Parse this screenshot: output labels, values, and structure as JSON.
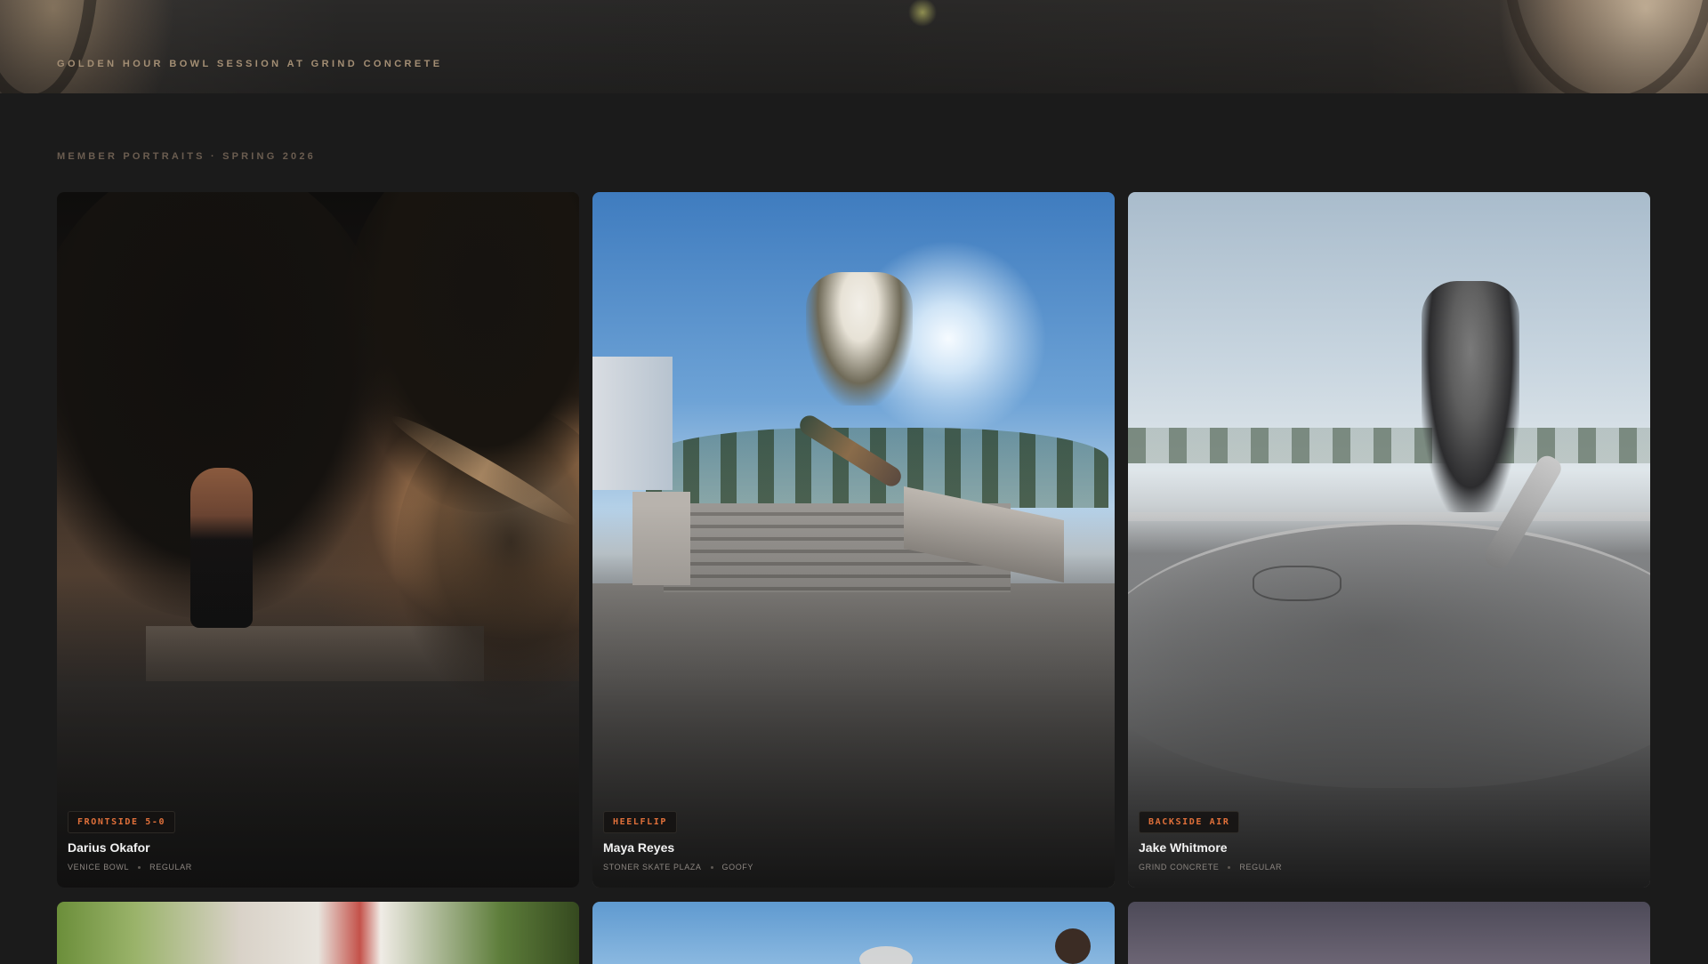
{
  "hero": {
    "caption": "GOLDEN HOUR BOWL SESSION AT GRIND CONCRETE"
  },
  "section": {
    "heading": "MEMBER PORTRAITS · SPRING 2026"
  },
  "cards": [
    {
      "trick": "FRONTSIDE 5-0",
      "name": "Darius Okafor",
      "spot": "VENICE BOWL",
      "stance": "REGULAR"
    },
    {
      "trick": "HEELFLIP",
      "name": "Maya Reyes",
      "spot": "STONER SKATE PLAZA",
      "stance": "GOOFY"
    },
    {
      "trick": "BACKSIDE AIR",
      "name": "Jake Whitmore",
      "spot": "GRIND CONCRETE",
      "stance": "REGULAR"
    }
  ],
  "colors": {
    "background": "#1b1b1b",
    "accent": "#e0703a",
    "caption": "#a38e74",
    "heading": "#6b5d50"
  }
}
